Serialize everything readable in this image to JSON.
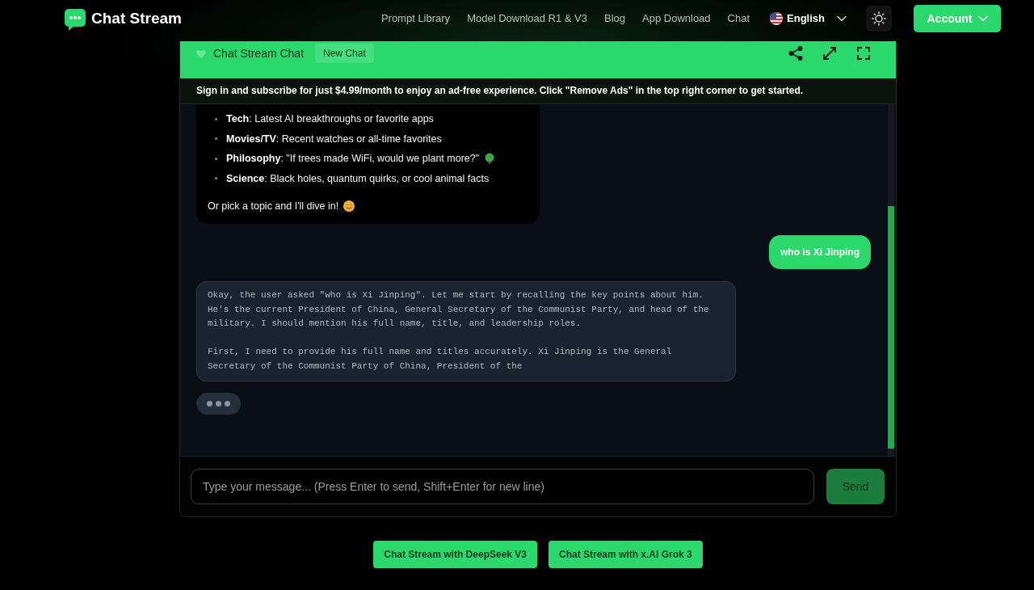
{
  "header": {
    "brand": "Chat Stream",
    "nav": [
      "Prompt Library",
      "Model Download R1 & V3",
      "Blog",
      "App Download",
      "Chat"
    ],
    "language": "English",
    "account_button": "Account"
  },
  "chat": {
    "title": "Chat Stream Chat",
    "new_chat_button": "New Chat",
    "notice": "Sign in and subscribe for just $4.99/month to enjoy an ad-free experience. Click \"Remove Ads\" in the top right corner to get started.",
    "messages": [
      {
        "kind": "assistant",
        "items": [
          "**Tech**: Latest AI breakthroughs or favorite apps",
          "**Movies/TV**: Recent watches or all-time favorites",
          "**Philosophy**: \"If trees made WiFi, would we plant more?\"",
          "**Science**: Black holes, quantum quirks, or cool animal facts"
        ],
        "closing": "Or pick a topic and I'll dive in!"
      },
      {
        "kind": "user",
        "text": "who is Xi Jinping"
      },
      {
        "kind": "reasoning",
        "paragraphs": [
          "Okay, the user asked \"who is Xi Jinping\". Let me start by recalling the key points about him. He's the current President of China, General Secretary of the Communist Party, and head of the military. I should mention his full name, title, and leadership roles.",
          "First, I need to provide his full name and titles accurately. Xi Jinping is the General Secretary of the Communist Party of China, President of the"
        ]
      },
      {
        "kind": "typing"
      }
    ],
    "input": {
      "placeholder": "Type your message... (Press Enter to send, Shift+Enter for new line)"
    },
    "send_button": "Send"
  },
  "footer_links": [
    "Chat Stream with DeepSeek V3",
    "Chat Stream with x.AI Grok 3"
  ]
}
